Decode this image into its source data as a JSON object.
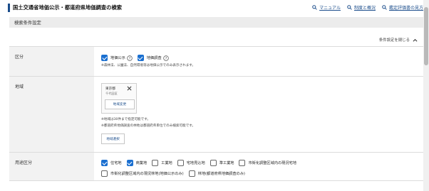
{
  "header": {
    "title": "国土交通省地価公示・都道府県地価調査の検索",
    "links": [
      {
        "label": "マニュアル",
        "icon": "search-icon"
      },
      {
        "label": "制度と概況",
        "icon": "search-icon"
      },
      {
        "label": "鑑定評価書の見方",
        "icon": "search-icon"
      }
    ]
  },
  "section": {
    "title": "検索条件設定",
    "toggle_label": "条件設定を閉じる"
  },
  "kubun": {
    "label": "区分",
    "options": [
      {
        "label": "地価公示",
        "checked": true
      },
      {
        "label": "地価調査",
        "checked": true
      }
    ],
    "note": "※森林法、公園法、自然環境等は地価公示でのみ表示されます。"
  },
  "chiiki": {
    "label": "地域",
    "selected_pref": "東京都",
    "selected_city": "千代田区",
    "change_label": "地域変更",
    "note1": "※地域は30件まで指定可能です。",
    "note2": "※都道府県地価調査の林地は都道府県単位でのみ検索可能です。",
    "select_label": "地域選択"
  },
  "youto": {
    "label": "用途区分",
    "row1": [
      {
        "label": "住宅地",
        "checked": true
      },
      {
        "label": "商業地",
        "checked": true
      },
      {
        "label": "工業地",
        "checked": false
      },
      {
        "label": "宅地見込地",
        "checked": false
      },
      {
        "label": "準工業地",
        "checked": false
      },
      {
        "label": "市街化調整区域内の現況宅地",
        "checked": false
      }
    ],
    "row2": [
      {
        "label": "市街化調整区域内の現況林地(地価公示のみ)",
        "checked": false
      },
      {
        "label": "林地(都道府県地価調査のみ)",
        "checked": false
      }
    ]
  },
  "colors": {
    "accent": "#1a6fd0",
    "title_bar": "#1a4c8b",
    "section_bg": "#ececec",
    "label_bg": "#f2f2f2"
  }
}
